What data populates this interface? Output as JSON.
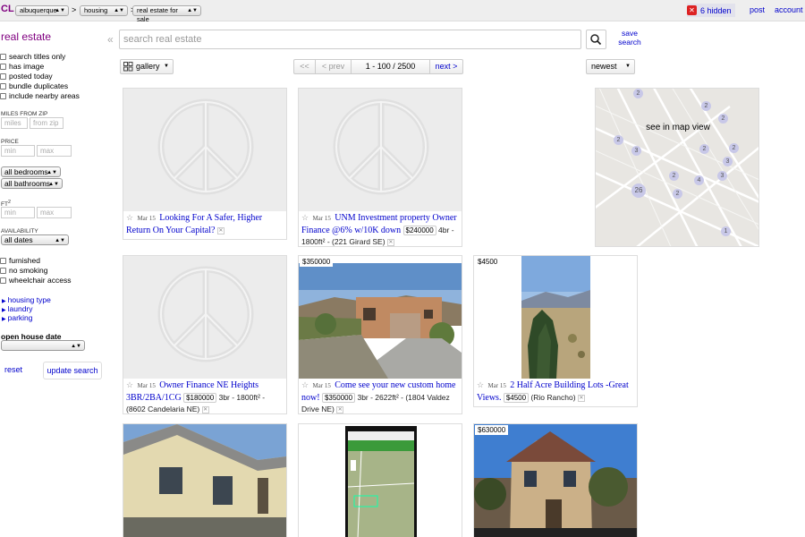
{
  "header": {
    "logo": "CL",
    "crumbs": [
      "albuquerque",
      "housing",
      "real estate for sale"
    ],
    "hidden_count": "6 hidden",
    "links": [
      "post",
      "account"
    ]
  },
  "sidebar": {
    "title": "real estate",
    "collapse_glyph": "«",
    "checkboxes": [
      "search titles only",
      "has image",
      "posted today",
      "bundle duplicates",
      "include nearby areas"
    ],
    "miles_label": "MILES FROM ZIP",
    "miles_placeholder": "miles",
    "from_zip_placeholder": "from zip",
    "price_label": "PRICE",
    "min_placeholder": "min",
    "max_placeholder": "max",
    "bedrooms": "all bedrooms",
    "bathrooms": "all bathrooms",
    "ft_label": "FT",
    "ft_sup": "2",
    "availability_label": "AVAILABILITY",
    "availability": "all dates",
    "amenities": [
      "furnished",
      "no smoking",
      "wheelchair access"
    ],
    "toggles": [
      "housing type",
      "laundry",
      "parking"
    ],
    "open_house_label": "open house date",
    "reset": "reset",
    "update": "update search"
  },
  "search": {
    "placeholder": "search real estate",
    "save_label": "save search"
  },
  "controls": {
    "view": "gallery",
    "first": "<<",
    "prev": "< prev",
    "range": "1 - 100 / 2500",
    "next": "next >",
    "sort": "newest"
  },
  "map": {
    "label": "see in map view",
    "pins": [
      "2",
      "2",
      "2",
      "2",
      "2",
      "2",
      "3",
      "3",
      "3",
      "2",
      "2",
      "4",
      "26",
      "1"
    ]
  },
  "listings": [
    {
      "price_tag": "",
      "date": "Mar 15",
      "title": "Looking For A Safer, Higher Return On Your Capital?",
      "price": "",
      "details": ""
    },
    {
      "price_tag": "",
      "date": "Mar 15",
      "title": "UNM Investment property Owner Finance @6% w/10K down",
      "price": "$240000",
      "details": "4br - 1800ft² - (221 Girard SE)"
    },
    {
      "price_tag": "",
      "date": "Mar 15",
      "title": "Owner Finance NE Heights 3BR/2BA/1CG",
      "price": "$180000",
      "details": "3br - 1800ft² - (8602 Candelaria NE)"
    },
    {
      "price_tag": "$350000",
      "date": "Mar 15",
      "title": "Come see your new custom home now!",
      "price": "$350000",
      "details": "3br - 2622ft² - (1804 Valdez Drive NE)"
    },
    {
      "price_tag": "$4500",
      "date": "Mar 15",
      "title": "2 Half Acre Building Lots -Great Views.",
      "price": "$4500",
      "details": "(Rio Rancho)"
    },
    {
      "price_tag": "",
      "date": "",
      "title": "",
      "price": "",
      "details": ""
    },
    {
      "price_tag": "",
      "date": "",
      "title": "",
      "price": "",
      "details": ""
    },
    {
      "price_tag": "$630000",
      "date": "",
      "title": "",
      "price": "",
      "details": ""
    }
  ]
}
